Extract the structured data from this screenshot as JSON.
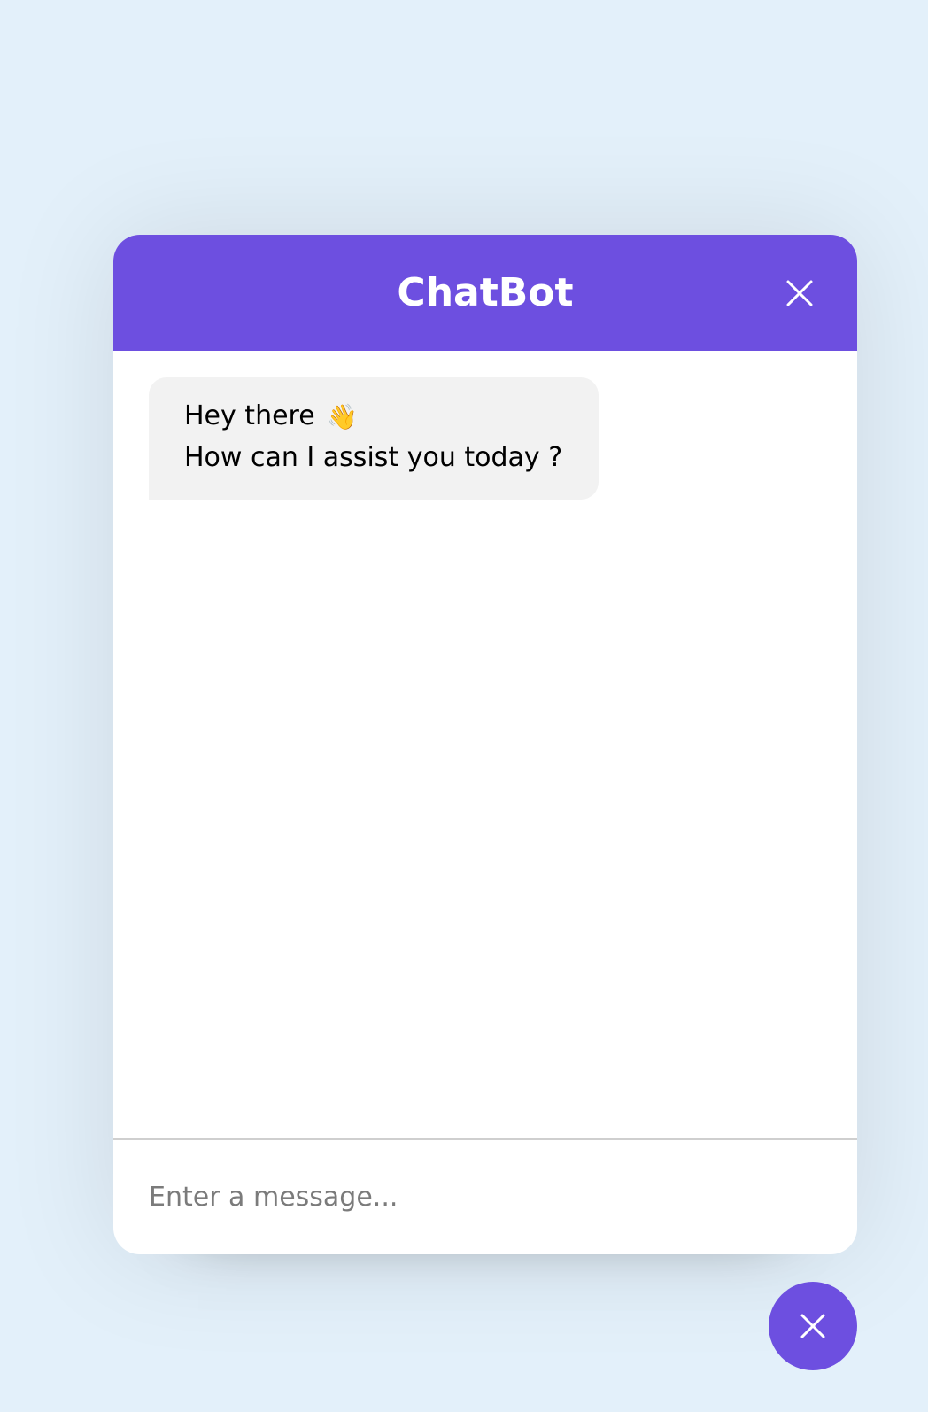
{
  "header": {
    "title": "ChatBot",
    "close_icon": "close-icon"
  },
  "messages": [
    {
      "sender": "bot",
      "lines": [
        "Hey there",
        "How can I assist you today ?"
      ],
      "emoji": "👋"
    }
  ],
  "input": {
    "placeholder": "Enter a message...",
    "value": ""
  },
  "toggler": {
    "icon": "close-icon"
  },
  "colors": {
    "brand": "#6d4fe0",
    "page_background": "#e3f0fa",
    "bubble_background": "#f2f2f2"
  }
}
